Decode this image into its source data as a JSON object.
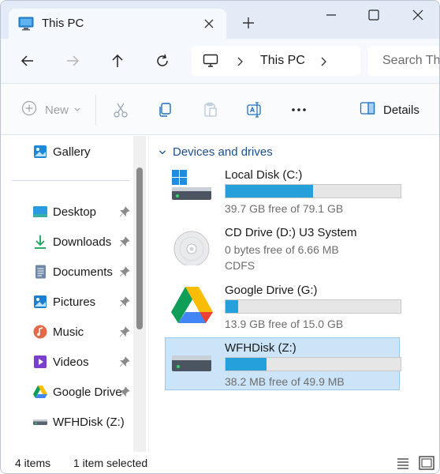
{
  "window": {
    "tab_title": "This PC",
    "new_tab_symbol": "+"
  },
  "navigation": {
    "address_segment": "This PC",
    "search_placeholder": "Search This PC"
  },
  "commands": {
    "new_label": "New",
    "details_label": "Details"
  },
  "sidebar": {
    "gallery": "Gallery",
    "items": [
      {
        "label": "Desktop",
        "icon": "desktop-icon",
        "pinned": true
      },
      {
        "label": "Downloads",
        "icon": "downloads-icon",
        "pinned": true
      },
      {
        "label": "Documents",
        "icon": "documents-icon",
        "pinned": true
      },
      {
        "label": "Pictures",
        "icon": "pictures-icon",
        "pinned": true
      },
      {
        "label": "Music",
        "icon": "music-icon",
        "pinned": true
      },
      {
        "label": "Videos",
        "icon": "videos-icon",
        "pinned": true
      },
      {
        "label": "Google Drive",
        "icon": "google-drive-icon",
        "pinned": true
      },
      {
        "label": "WFHDisk (Z:)",
        "icon": "drive-icon",
        "pinned": false
      }
    ]
  },
  "main": {
    "group_header": "Devices and drives",
    "drives": [
      {
        "name": "Local Disk (C:)",
        "free_text": "39.7 GB free of 79.1 GB",
        "used_fraction": 0.498,
        "icon": "windows-drive-icon"
      },
      {
        "name": "CD Drive (D:) U3 System",
        "free_text": "0 bytes free of 6.66 MB",
        "filesystem": "CDFS",
        "icon": "cd-drive-icon"
      },
      {
        "name": "Google Drive (G:)",
        "free_text": "13.9 GB free of 15.0 GB",
        "used_fraction": 0.073,
        "icon": "google-drive-icon"
      },
      {
        "name": "WFHDisk (Z:)",
        "free_text": "38.2 MB free of 49.9 MB",
        "used_fraction": 0.234,
        "icon": "drive-icon",
        "selected": true
      }
    ]
  },
  "status": {
    "item_count": "4 items",
    "selection": "1 item selected"
  },
  "colors": {
    "accent": "#26a0da",
    "selection": "#cce4f7",
    "group_header": "#1b4f8c"
  }
}
